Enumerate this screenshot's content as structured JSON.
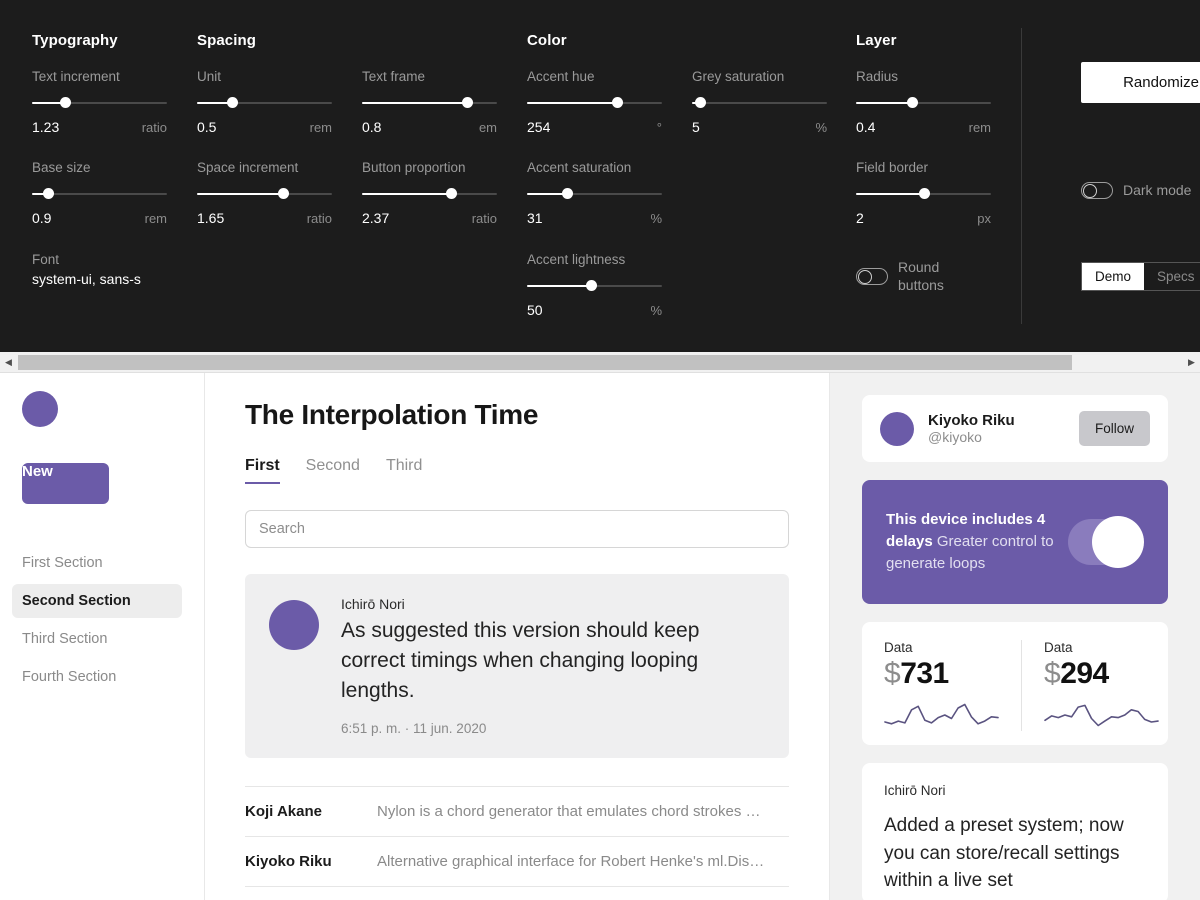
{
  "panel": {
    "groups": [
      {
        "title": "Typography",
        "controls": [
          {
            "label": "Text increment",
            "value": "1.23",
            "unit": "ratio",
            "pct": 25
          },
          {
            "label": "Base size",
            "value": "0.9",
            "unit": "rem",
            "pct": 12
          }
        ]
      },
      {
        "title": "Spacing",
        "controls": [
          {
            "label": "Unit",
            "value": "0.5",
            "unit": "rem",
            "pct": 26
          },
          {
            "label": "Space increment",
            "value": "1.65",
            "unit": "ratio",
            "pct": 64
          },
          {
            "label": "Text frame",
            "value": "0.8",
            "unit": "em",
            "pct": 78
          },
          {
            "label": "Button proportion",
            "value": "2.37",
            "unit": "ratio",
            "pct": 66
          }
        ]
      },
      {
        "title": "Color",
        "controls": [
          {
            "label": "Accent hue",
            "value": "254",
            "unit": "°",
            "pct": 67
          },
          {
            "label": "Accent saturation",
            "value": "31",
            "unit": "%",
            "pct": 30
          },
          {
            "label": "Accent lightness",
            "value": "50",
            "unit": "%",
            "pct": 48
          },
          {
            "label": "Grey saturation",
            "value": "5",
            "unit": "%",
            "pct": 6
          }
        ]
      },
      {
        "title": "Layer",
        "controls": [
          {
            "label": "Radius",
            "value": "0.4",
            "unit": "rem",
            "pct": 42
          },
          {
            "label": "Field border",
            "value": "2",
            "unit": "px",
            "pct": 51
          }
        ]
      }
    ],
    "font": {
      "label": "Font",
      "value": "system-ui, sans-s"
    },
    "toggles": {
      "round_buttons": "Round buttons",
      "dark_mode": "Dark mode"
    },
    "randomize_label": "Randomize",
    "segmented": {
      "demo": "Demo",
      "specs": "Specs",
      "selected": "Demo"
    },
    "scrollbar": {
      "left_arrow": "◀",
      "right_arrow": "▶"
    }
  },
  "accent_color": "#6B5BA8",
  "sidebar": {
    "new_label": "New",
    "items": [
      {
        "label": "First Section",
        "active": false
      },
      {
        "label": "Second Section",
        "active": true
      },
      {
        "label": "Third Section",
        "active": false
      },
      {
        "label": "Fourth Section",
        "active": false
      }
    ]
  },
  "main": {
    "title": "The Interpolation Time",
    "tabs": [
      {
        "label": "First",
        "active": true
      },
      {
        "label": "Second",
        "active": false
      },
      {
        "label": "Third",
        "active": false
      }
    ],
    "search": {
      "value": "",
      "placeholder": "Search"
    },
    "post": {
      "author": "Ichirō Nori",
      "text": "As suggested this version should keep correct timings when changing looping lengths.",
      "timestamp": "6:51 p. m. · 11 jun. 2020"
    },
    "rows": [
      {
        "name": "Koji Akane",
        "desc": "Nylon is a chord generator that emulates chord strokes …"
      },
      {
        "name": "Kiyoko Riku",
        "desc": "Alternative graphical interface for Robert Henke's ml.Dis…"
      }
    ]
  },
  "aside": {
    "profile": {
      "name": "Kiyoko Riku",
      "handle": "@kiyoko",
      "follow_label": "Follow"
    },
    "promo": {
      "bold_lead": "This device includes 4 delays",
      "rest": " Greater control to generate loops"
    },
    "data_cards": [
      {
        "label": "Data",
        "currency": "$",
        "value": "731"
      },
      {
        "label": "Data",
        "currency": "$",
        "value": "294"
      }
    ],
    "note": {
      "author": "Ichirō Nori",
      "text": "Added a preset system; now you can store/recall settings within a live set"
    }
  },
  "chart_data": [
    {
      "type": "line",
      "title": "Data",
      "values": [
        8,
        6,
        9,
        7,
        22,
        26,
        10,
        7,
        13,
        16,
        12,
        24,
        28,
        14,
        6,
        9,
        14,
        13
      ],
      "ylim": [
        0,
        32
      ],
      "grid": false
    },
    {
      "type": "line",
      "title": "Data",
      "values": [
        10,
        15,
        13,
        16,
        14,
        25,
        27,
        12,
        4,
        9,
        14,
        13,
        16,
        22,
        20,
        11,
        8,
        9
      ],
      "ylim": [
        0,
        32
      ],
      "grid": false
    }
  ]
}
